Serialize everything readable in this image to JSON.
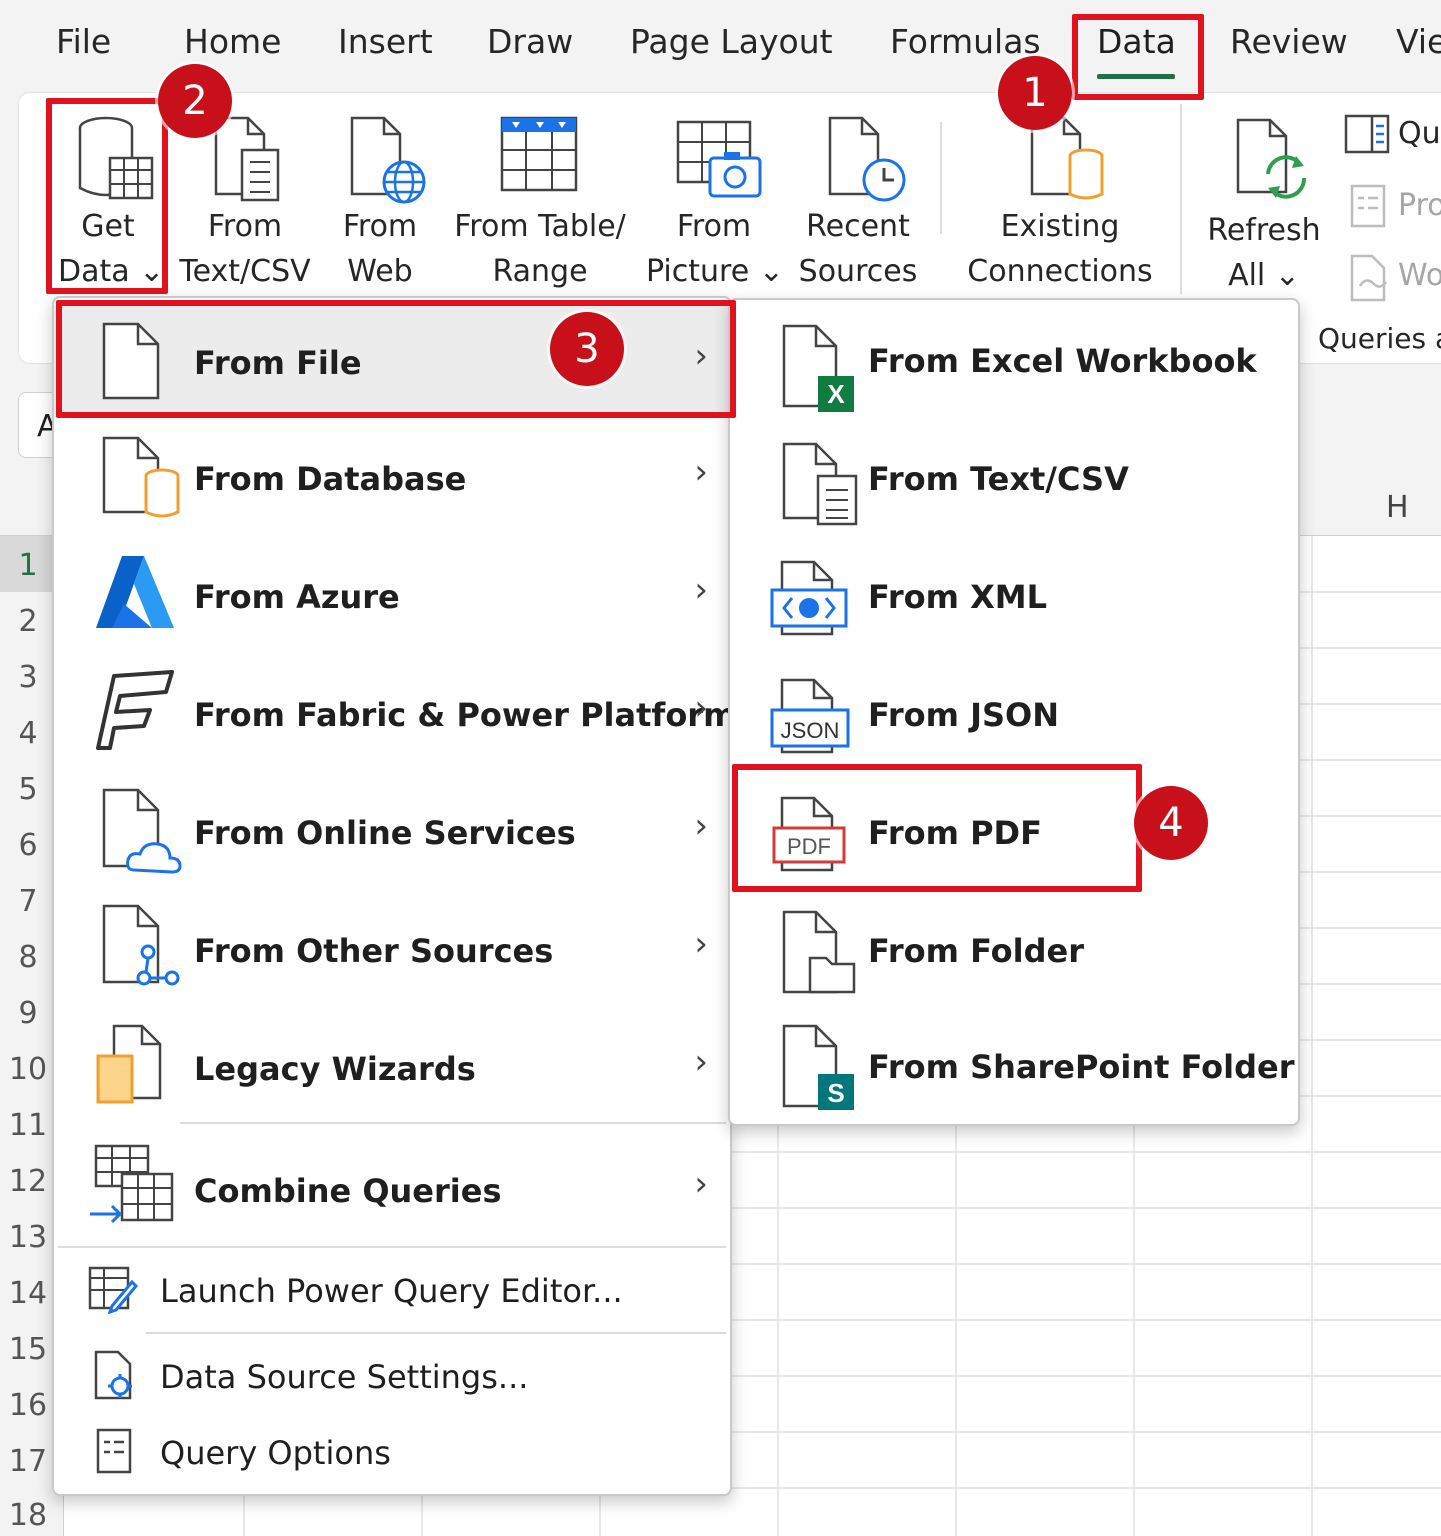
{
  "tabs": [
    "File",
    "Home",
    "Insert",
    "Draw",
    "Page Layout",
    "Formulas",
    "Data",
    "Review",
    "Vie"
  ],
  "active_tab": "Data",
  "ribbon": {
    "get_data": [
      "Get",
      "Data ⌄"
    ],
    "from_text_csv": [
      "From",
      "Text/CSV"
    ],
    "from_web": [
      "From",
      "Web"
    ],
    "from_table_range": [
      "From Table/",
      "Range"
    ],
    "from_picture": [
      "From",
      "Picture ⌄"
    ],
    "recent_sources": [
      "Recent",
      "Sources"
    ],
    "existing_connections": [
      "Existing",
      "Connections"
    ],
    "refresh_all": [
      "Refresh",
      "All ⌄"
    ],
    "queries_label": "Queries",
    "queries_short": "Qu",
    "properties_short": "Pro",
    "workbook_links_short": "Wo",
    "queries_group": "Queries a"
  },
  "namebox": "A",
  "column_header_visible": "H",
  "rows": [
    "1",
    "2",
    "3",
    "4",
    "5",
    "6",
    "7",
    "8",
    "9",
    "10",
    "11",
    "12",
    "13",
    "14",
    "15",
    "16",
    "17",
    "18"
  ],
  "get_data_menu": {
    "from_file": "From File",
    "from_database": "From Database",
    "from_azure": "From Azure",
    "from_fabric": "From Fabric & Power Platform",
    "from_online": "From Online Services",
    "from_other": "From Other Sources",
    "legacy": "Legacy Wizards",
    "combine": "Combine Queries",
    "launch_pq": "Launch Power Query Editor...",
    "data_source": "Data Source Settings...",
    "query_options": "Query Options"
  },
  "from_file_menu": {
    "excel": "From Excel Workbook",
    "text_csv": "From Text/CSV",
    "xml": "From XML",
    "json": "From JSON",
    "pdf": "From PDF",
    "folder": "From Folder",
    "sharepoint": "From SharePoint Folder"
  },
  "icon_text": {
    "excel_x": "X",
    "json_tag": "JSON",
    "pdf_tag": "PDF",
    "sharepoint_s": "S"
  },
  "callouts": [
    "1",
    "2",
    "3",
    "4"
  ],
  "colors": {
    "accent_green": "#1e7145",
    "highlight_red": "#e0121f",
    "badge_red": "#c8101a",
    "icon_blue": "#1a73e8",
    "icon_orange": "#f0a030",
    "excel_green": "#107c41",
    "sharepoint_teal": "#03787c"
  }
}
